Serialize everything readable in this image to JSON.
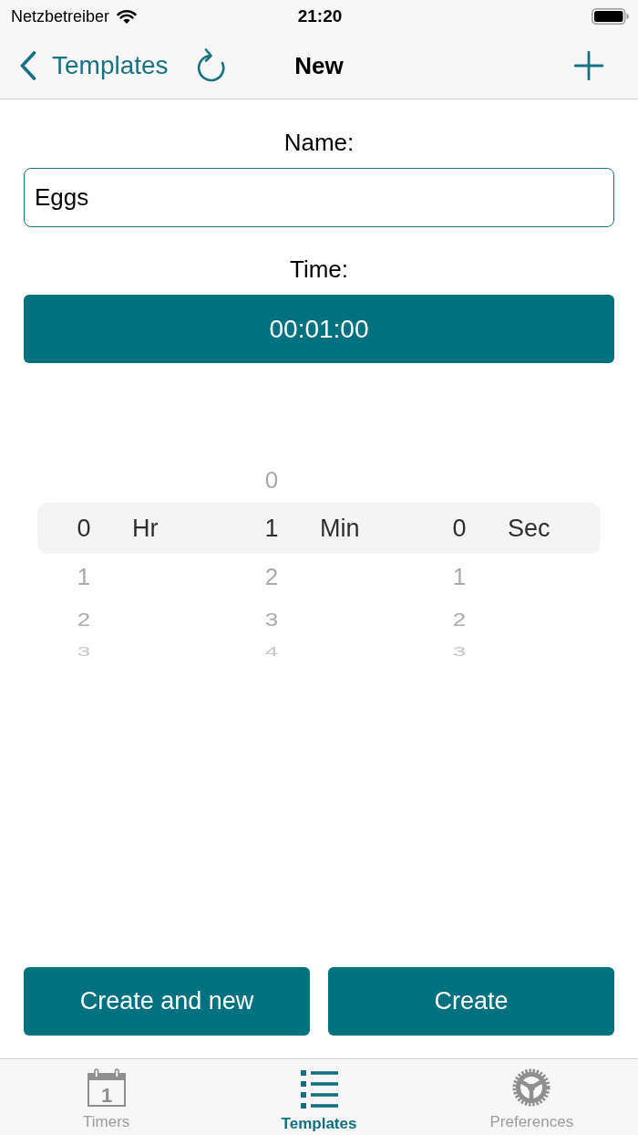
{
  "status_bar": {
    "carrier": "Netzbetreiber",
    "time": "21:20"
  },
  "nav_bar": {
    "back_label": "Templates",
    "title": "New"
  },
  "form": {
    "name_label": "Name:",
    "name_value": "Eggs",
    "time_label": "Time:",
    "time_value": "00:01:00"
  },
  "picker": {
    "columns": [
      {
        "value": "0",
        "unit": "Hr",
        "below": [
          "1",
          "2",
          "3"
        ]
      },
      {
        "above": [
          "0"
        ],
        "value": "1",
        "unit": "Min",
        "below": [
          "2",
          "3",
          "4"
        ]
      },
      {
        "value": "0",
        "unit": "Sec",
        "below": [
          "1",
          "2",
          "3"
        ]
      }
    ]
  },
  "buttons": [
    {
      "label": "Create and new"
    },
    {
      "label": "Create"
    }
  ],
  "tabs": [
    {
      "label": "Timers",
      "icon_text": "1",
      "selected": false
    },
    {
      "label": "Templates",
      "selected": true
    },
    {
      "label": "Preferences",
      "selected": false
    }
  ]
}
